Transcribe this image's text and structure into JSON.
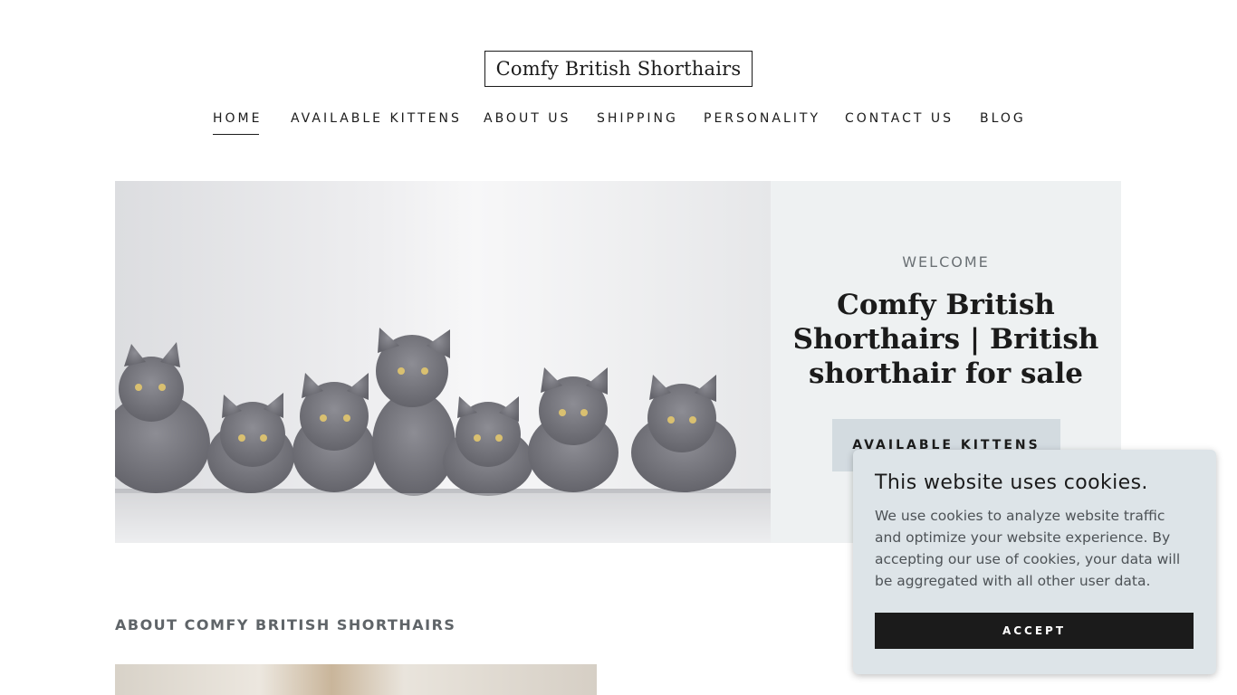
{
  "header": {
    "logo_text": "Comfy British Shorthairs"
  },
  "nav": {
    "items": [
      {
        "label": "HOME",
        "active": true
      },
      {
        "label": "AVAILABLE KITTENS"
      },
      {
        "label": "ABOUT US"
      },
      {
        "label": "SHIPPING"
      },
      {
        "label": "PERSONALITY"
      },
      {
        "label": "CONTACT US"
      },
      {
        "label": "BLOG"
      }
    ]
  },
  "hero": {
    "image_icon": "kittens-photo",
    "eyebrow": "WELCOME",
    "title": "Comfy British Shorthairs | British shorthair for sale",
    "button_label": "AVAILABLE KITTENS"
  },
  "about": {
    "heading": "ABOUT COMFY BRITISH SHORTHAIRS"
  },
  "cookie_banner": {
    "title": "This website uses cookies.",
    "body": "We use cookies to analyze website traffic and optimize your website experience. By accepting our use of cookies, your data will be aggregated with all other user data.",
    "accept_label": "ACCEPT"
  },
  "colors": {
    "text": "#1b1b1b",
    "hero_bg": "#eef1f2",
    "button_bg": "#d3dbe0",
    "cookie_bg": "#dde4e8",
    "accept_bg": "#1b1b1b"
  }
}
